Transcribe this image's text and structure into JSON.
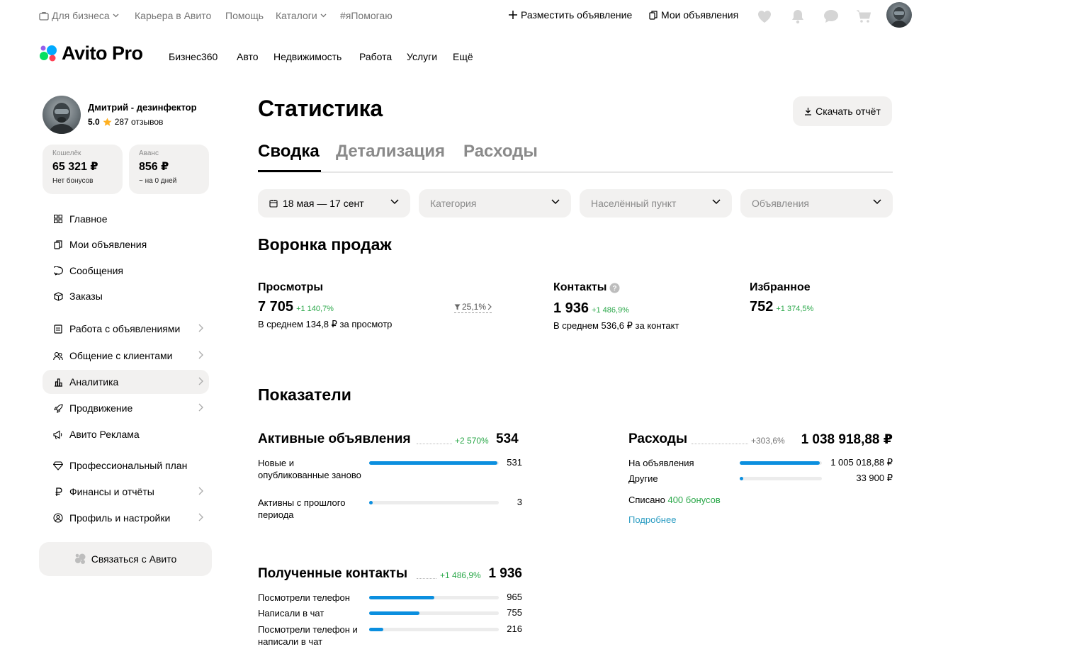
{
  "topbar": {
    "business": "Для бизнеса",
    "career": "Карьера в Авито",
    "help": "Помощь",
    "catalogs": "Каталоги",
    "ihelp": "#яПомогаю",
    "post_ad": "Разместить объявление",
    "my_ads": "Мои объявления"
  },
  "brand": {
    "logo": "Avito Pro",
    "nav": [
      "Бизнес360",
      "Авто",
      "Недвижимость",
      "Работа",
      "Услуги",
      "Ещё"
    ]
  },
  "profile": {
    "name": "Дмитрий - дезинфектор",
    "rating": "5.0",
    "reviews": "287 отзывов"
  },
  "wallets": {
    "wallet": {
      "label": "Кошелёк",
      "value": "65 321 ₽",
      "sub": "Нет бонусов"
    },
    "advance": {
      "label": "Аванс",
      "value": "856 ₽",
      "sub": "~ на 0 дней"
    }
  },
  "sidebar": {
    "items": [
      {
        "label": "Главное",
        "icon": "grid-icon"
      },
      {
        "label": "Мои объявления",
        "icon": "copy-icon"
      },
      {
        "label": "Сообщения",
        "icon": "chat-icon"
      },
      {
        "label": "Заказы",
        "icon": "box-icon"
      },
      {
        "label": "Работа с объявлениями",
        "icon": "ads-icon"
      },
      {
        "label": "Общение с клиентами",
        "icon": "users-icon"
      },
      {
        "label": "Аналитика",
        "icon": "chart-icon"
      },
      {
        "label": "Продвижение",
        "icon": "rocket-icon"
      },
      {
        "label": "Авито Реклама",
        "icon": "megaphone-icon"
      },
      {
        "label": "Профессиональный план",
        "icon": "diamond-icon"
      },
      {
        "label": "Финансы и отчёты",
        "icon": "ruble-icon"
      },
      {
        "label": "Профиль и настройки",
        "icon": "user-icon"
      }
    ],
    "contact_avito": "Связаться с Авито"
  },
  "page": {
    "title": "Статистика",
    "download": "Скачать отчёт",
    "tabs": [
      "Сводка",
      "Детализация",
      "Расходы"
    ],
    "active_tab": "Сводка"
  },
  "filters": {
    "dates": "18 мая — 17 сент",
    "category": "Категория",
    "city": "Населённый пункт",
    "ads": "Объявления"
  },
  "funnel": {
    "title": "Воронка продаж",
    "views": {
      "label": "Просмотры",
      "value": "7 705",
      "delta": "+1 140,7%",
      "sub": "В среднем 134,8 ₽ за просмотр"
    },
    "conversion": "25,1%",
    "contacts": {
      "label": "Контакты",
      "value": "1 936",
      "delta": "+1 486,9%",
      "sub": "В среднем 536,6 ₽ за контакт"
    },
    "favorites": {
      "label": "Избранное",
      "value": "752",
      "delta": "+1 374,5%"
    }
  },
  "indicators": {
    "title": "Показатели",
    "active_ads": {
      "title": "Активные объявления",
      "delta": "+2 570%",
      "total": "534",
      "rows": [
        {
          "label": "Новые и опубликованные заново",
          "value": "531",
          "fraction": 0.994
        },
        {
          "label": "Активны с прошлого периода",
          "value": "3",
          "fraction": 0.02
        }
      ]
    },
    "expenses": {
      "title": "Расходы",
      "delta": "+303,6%",
      "total": "1 038 918,88 ₽",
      "rows": [
        {
          "label": "На объявления",
          "value": "1 005 018,88 ₽",
          "fraction": 0.967
        },
        {
          "label": "Другие",
          "value": "33 900 ₽",
          "fraction": 0.04
        }
      ],
      "bonus_prefix": "Списано",
      "bonus_value": "400 бонусов",
      "more": "Подробнее"
    },
    "contacts": {
      "title": "Полученные контакты",
      "delta": "+1 486,9%",
      "total": "1 936",
      "rows": [
        {
          "label": "Посмотрели телефон",
          "value": "965",
          "fraction": 0.498
        },
        {
          "label": "Написали в чат",
          "value": "755",
          "fraction": 0.39
        },
        {
          "label": "Посмотрели телефон и написали в чат",
          "value": "216",
          "fraction": 0.112
        }
      ]
    }
  },
  "colors": {
    "accent_blue": "#0b8fdf",
    "delta_green": "#2ba84a",
    "link": "#2a9cc2",
    "surface": "#f2f1f0"
  }
}
